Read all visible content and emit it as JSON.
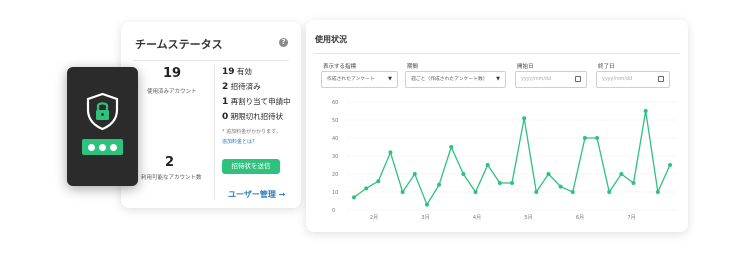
{
  "team_status": {
    "title": "チームステータス",
    "help_icon": "question-icon",
    "used_accounts": {
      "value": "19",
      "label": "使用済みアカウント"
    },
    "available_accounts": {
      "value": "2",
      "label": "利用可能なアカウント数"
    },
    "stats": [
      {
        "num": "19",
        "label": "有効"
      },
      {
        "num": "2",
        "label": "招待済み"
      },
      {
        "num": "1",
        "label": "再割り当て申請中"
      },
      {
        "num": "0",
        "label": "期限切れ招待状"
      }
    ],
    "note": "* 追加料金がかかります。",
    "note_link": "追加料金とは？",
    "send_invite_button": "招待状を送信",
    "user_management_link": "ユーザー管理",
    "user_management_arrow": "→"
  },
  "device": {
    "icons": [
      "shield-lock-icon",
      "password-dots-icon"
    ],
    "accent": "#2ec27e"
  },
  "usage": {
    "title": "使用状況",
    "filters": [
      {
        "label": "表示する指標",
        "value": "作成されたアンケート",
        "type": "select"
      },
      {
        "label": "期間",
        "value": "週ごと（作成されたアンケート数）",
        "type": "select"
      },
      {
        "label": "開始日",
        "value": "yyyy/mm/dd",
        "type": "date"
      },
      {
        "label": "終了日",
        "value": "yyyy/mm/dd",
        "type": "date"
      }
    ]
  },
  "chart_data": {
    "type": "line",
    "y_ticks": [
      "0",
      "10",
      "20",
      "30",
      "40",
      "50",
      "60"
    ],
    "ylim": [
      0,
      60
    ],
    "x_ticks": [
      "2月",
      "3月",
      "4月",
      "5月",
      "6月",
      "7月"
    ],
    "grid": true,
    "color": "#2ec27e",
    "series": [
      {
        "values": [
          7,
          12,
          16,
          32,
          10,
          20,
          3,
          14,
          35,
          20,
          10,
          25,
          15,
          15,
          51,
          10,
          20,
          13,
          10,
          40,
          40,
          10,
          20,
          15,
          55,
          10,
          25
        ]
      }
    ]
  }
}
